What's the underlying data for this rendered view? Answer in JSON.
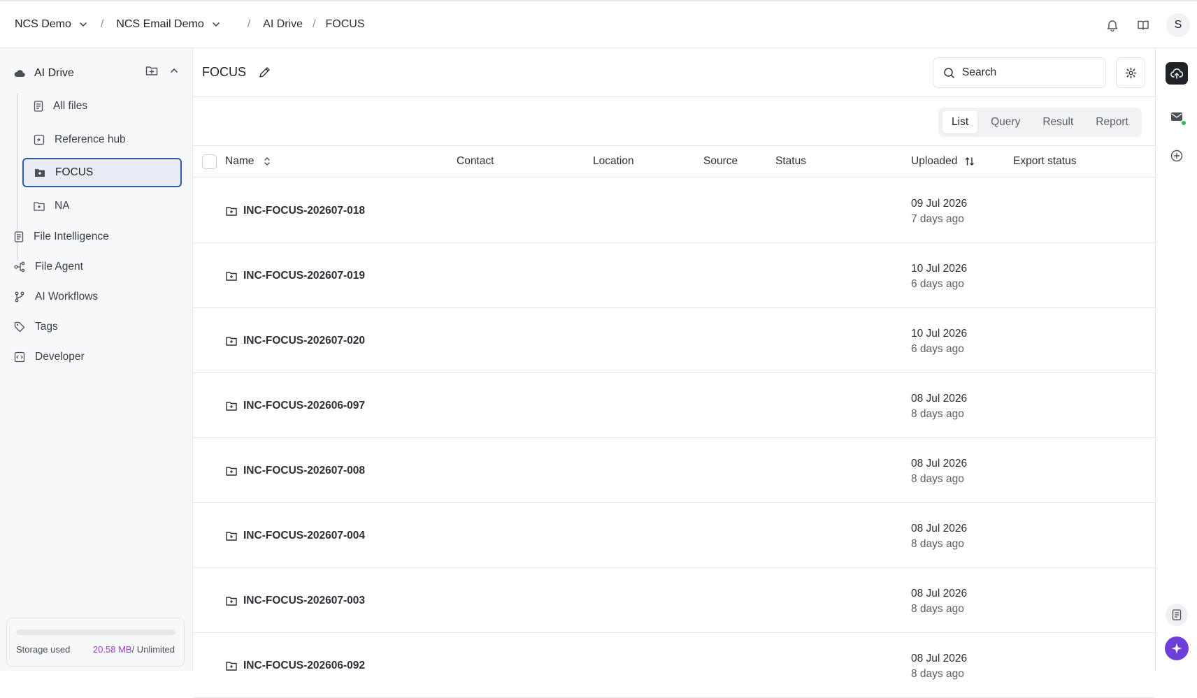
{
  "breadcrumb": {
    "org": "NCS Demo",
    "project": "NCS Email Demo",
    "drive": "AI Drive",
    "folder": "FOCUS"
  },
  "avatar_initial": "S",
  "sidebar": {
    "root_label": "AI Drive",
    "children": [
      {
        "label": "All files",
        "icon": "file-icon",
        "active": false
      },
      {
        "label": "Reference hub",
        "icon": "folder-link-icon",
        "active": false
      },
      {
        "label": "FOCUS",
        "icon": "folder-icon",
        "active": true
      },
      {
        "label": "NA",
        "icon": "folder-plus-icon",
        "active": false
      }
    ],
    "sections": [
      {
        "label": "File Intelligence",
        "icon": "document-icon"
      },
      {
        "label": "File Agent",
        "icon": "agent-icon"
      },
      {
        "label": "AI Workflows",
        "icon": "workflow-icon"
      },
      {
        "label": "Tags",
        "icon": "tag-icon"
      },
      {
        "label": "Developer",
        "icon": "code-icon"
      }
    ],
    "storage": {
      "label": "Storage used",
      "used": "20.58 MB",
      "limit": "/ Unlimited",
      "fill_fraction": 0.0
    }
  },
  "main": {
    "title": "FOCUS",
    "search_placeholder": "Search",
    "tabs": [
      {
        "label": "List",
        "active": true
      },
      {
        "label": "Query",
        "active": false
      },
      {
        "label": "Result",
        "active": false
      },
      {
        "label": "Report",
        "active": false
      }
    ],
    "columns": {
      "name": "Name",
      "contact": "Contact",
      "location": "Location",
      "source": "Source",
      "status": "Status",
      "uploaded": "Uploaded",
      "export_status": "Export status"
    },
    "rows": [
      {
        "name": "INC-FOCUS-202607-018",
        "date": "09 Jul 2026",
        "relative": "7 days ago"
      },
      {
        "name": "INC-FOCUS-202607-019",
        "date": "10 Jul 2026",
        "relative": "6 days ago"
      },
      {
        "name": "INC-FOCUS-202607-020",
        "date": "10 Jul 2026",
        "relative": "6 days ago"
      },
      {
        "name": "INC-FOCUS-202606-097",
        "date": "08 Jul 2026",
        "relative": "8 days ago"
      },
      {
        "name": "INC-FOCUS-202607-008",
        "date": "08 Jul 2026",
        "relative": "8 days ago"
      },
      {
        "name": "INC-FOCUS-202607-004",
        "date": "08 Jul 2026",
        "relative": "8 days ago"
      },
      {
        "name": "INC-FOCUS-202607-003",
        "date": "08 Jul 2026",
        "relative": "8 days ago"
      },
      {
        "name": "INC-FOCUS-202606-092",
        "date": "08 Jul 2026",
        "relative": "8 days ago"
      }
    ]
  },
  "colors": {
    "accent_border": "#2f5ba8",
    "storage_used": "#9b40c8",
    "ai_button": "#6d3fd6",
    "online_dot": "#2fb862"
  }
}
